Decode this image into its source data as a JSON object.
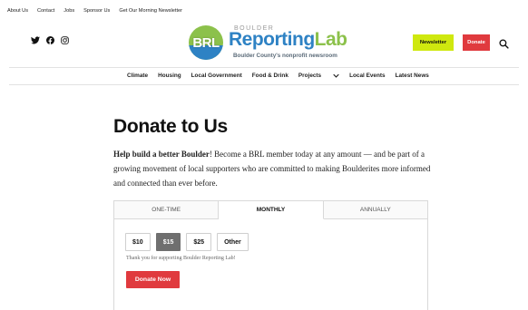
{
  "topnav": [
    "About Us",
    "Contact",
    "Jobs",
    "Sponsor Us",
    "Get Our Morning Newsletter"
  ],
  "social": {
    "icons": [
      "twitter-icon",
      "facebook-icon",
      "instagram-icon"
    ]
  },
  "logo": {
    "mark": "BRL",
    "small": "BOULDER",
    "name_part1": "Reporting",
    "name_part2": "Lab",
    "tagline": "Boulder County's nonprofit newsroom"
  },
  "header_buttons": {
    "newsletter": "Newsletter",
    "donate": "Donate"
  },
  "mainnav": [
    "Climate",
    "Housing",
    "Local Government",
    "Food & Drink",
    "Projects",
    "Local Events",
    "Latest News"
  ],
  "page": {
    "title": "Donate to Us",
    "intro_bold": "Help build a better Boulder",
    "intro_rest": "! Become a BRL member today at any amount — and be part of a growing movement of local supporters who are committed to making Boulderites more informed and connected than ever before."
  },
  "donation": {
    "tabs": [
      "ONE-TIME",
      "MONTHLY",
      "ANNUALLY"
    ],
    "active_tab": "MONTHLY",
    "amounts": [
      "$10",
      "$15",
      "$25",
      "Other"
    ],
    "selected_amount": "$15",
    "thanks": "Thank you for supporting Boulder Reporting Lab!",
    "submit": "Donate Now"
  },
  "colors": {
    "accent_red": "#e03a3e",
    "newsletter_yellow": "#cfe80f",
    "brand_blue": "#2e82c4",
    "brand_green": "#8cc14b"
  }
}
